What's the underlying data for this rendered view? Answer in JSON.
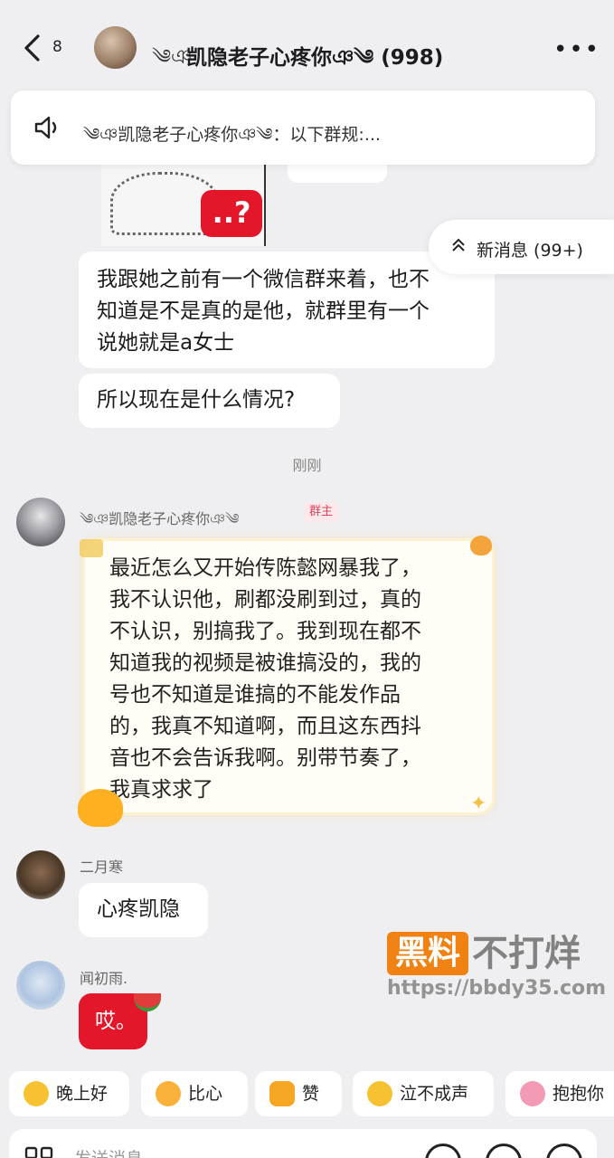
{
  "header": {
    "unread_count": "8",
    "deco_left": "༄ঞ",
    "group_title": "凯隐老子心疼你ঞ༄ (998)",
    "more_label": "•••"
  },
  "notice": {
    "text": "༄ঞ凯隐老子心疼你ঞ༄：以下群规:..."
  },
  "image_badge": "..?",
  "new_messages": {
    "label": "新消息 (99+)"
  },
  "messages": {
    "m1_lines": [
      "我跟她之前有一个微信群来着，也不",
      "知道是不是真的是他，就群里有一个",
      "说她就是a女士"
    ],
    "m2": "所以现在是什么情况?",
    "timestamp": "刚刚",
    "owner_name": "༄ঞ凯隐老子心疼你ঞ༄",
    "owner_badge": "群主",
    "m3_lines": [
      "最近怎么又开始传陈懿网暴我了，",
      "我不认识他，刷都没刷到过，真的",
      "不认识，别搞我了。我到现在都不",
      "知道我的视频是被谁搞没的，我的",
      "号也不知道是谁搞的不能发作品",
      "的，我真不知道啊，而且这东西抖",
      "音也不会告诉我啊。别带节奏了，",
      "我真求求了"
    ],
    "erye_name": "二月寒",
    "m4": "心疼凯隐",
    "wen_name": "闻初雨.",
    "m5": "哎。"
  },
  "watermark": {
    "box": "黑料",
    "text": "不打烊",
    "url": "https://bbdy35.com"
  },
  "quick_replies": [
    "晚上好",
    "比心",
    "赞",
    "泣不成声",
    "抱抱你"
  ],
  "input": {
    "placeholder": "发送消息"
  }
}
